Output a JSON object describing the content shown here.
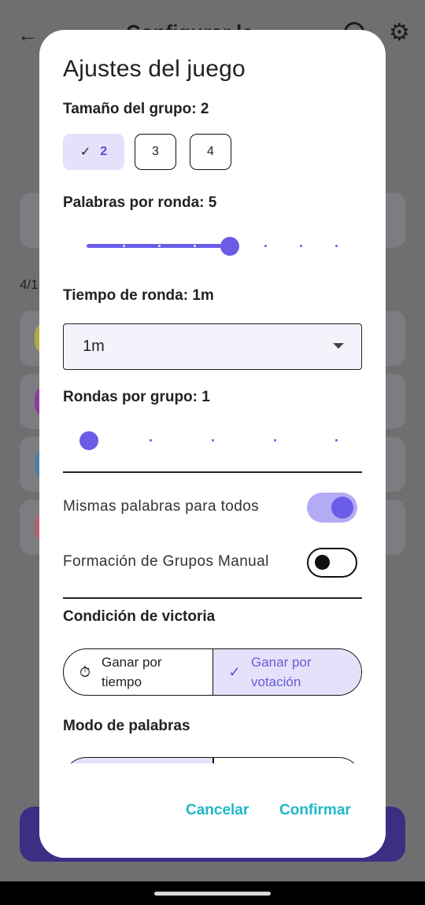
{
  "background": {
    "title": "Configurar la partida",
    "counter": "4/1",
    "colors": {
      "yellow": "#b2a845",
      "purple": "#8e3d9a",
      "blue": "#4d7fa4",
      "pink": "#b3616f"
    }
  },
  "dialog": {
    "title": "Ajustes del juego",
    "group_size": {
      "label": "Tamaño del grupo: 2",
      "options": [
        "2",
        "3",
        "4"
      ],
      "selected": "2"
    },
    "words_per_round": {
      "label": "Palabras por ronda: 5",
      "value": 5,
      "min": 1,
      "max": 8,
      "step": 1
    },
    "round_time": {
      "label": "Tiempo de ronda: 1m",
      "value": "1m"
    },
    "rounds_per_group": {
      "label": "Rondas por grupo: 1",
      "value": 1,
      "min": 1,
      "max": 5
    },
    "same_words": {
      "label": "Mismas palabras para todos",
      "enabled": true
    },
    "manual_groups": {
      "label": "Formación de Grupos Manual",
      "enabled": false
    },
    "win_condition": {
      "label": "Condición de victoria",
      "options": [
        {
          "text": "Ganar por tiempo",
          "icon": "timer-icon",
          "selected": false
        },
        {
          "text": "Ganar por votación",
          "icon": "check-icon",
          "selected": true
        }
      ]
    },
    "word_mode": {
      "label": "Modo de palabras"
    },
    "actions": {
      "cancel": "Cancelar",
      "confirm": "Confirmar"
    }
  },
  "accent": "#6b5ce7",
  "action_color": "#1fb8c8"
}
